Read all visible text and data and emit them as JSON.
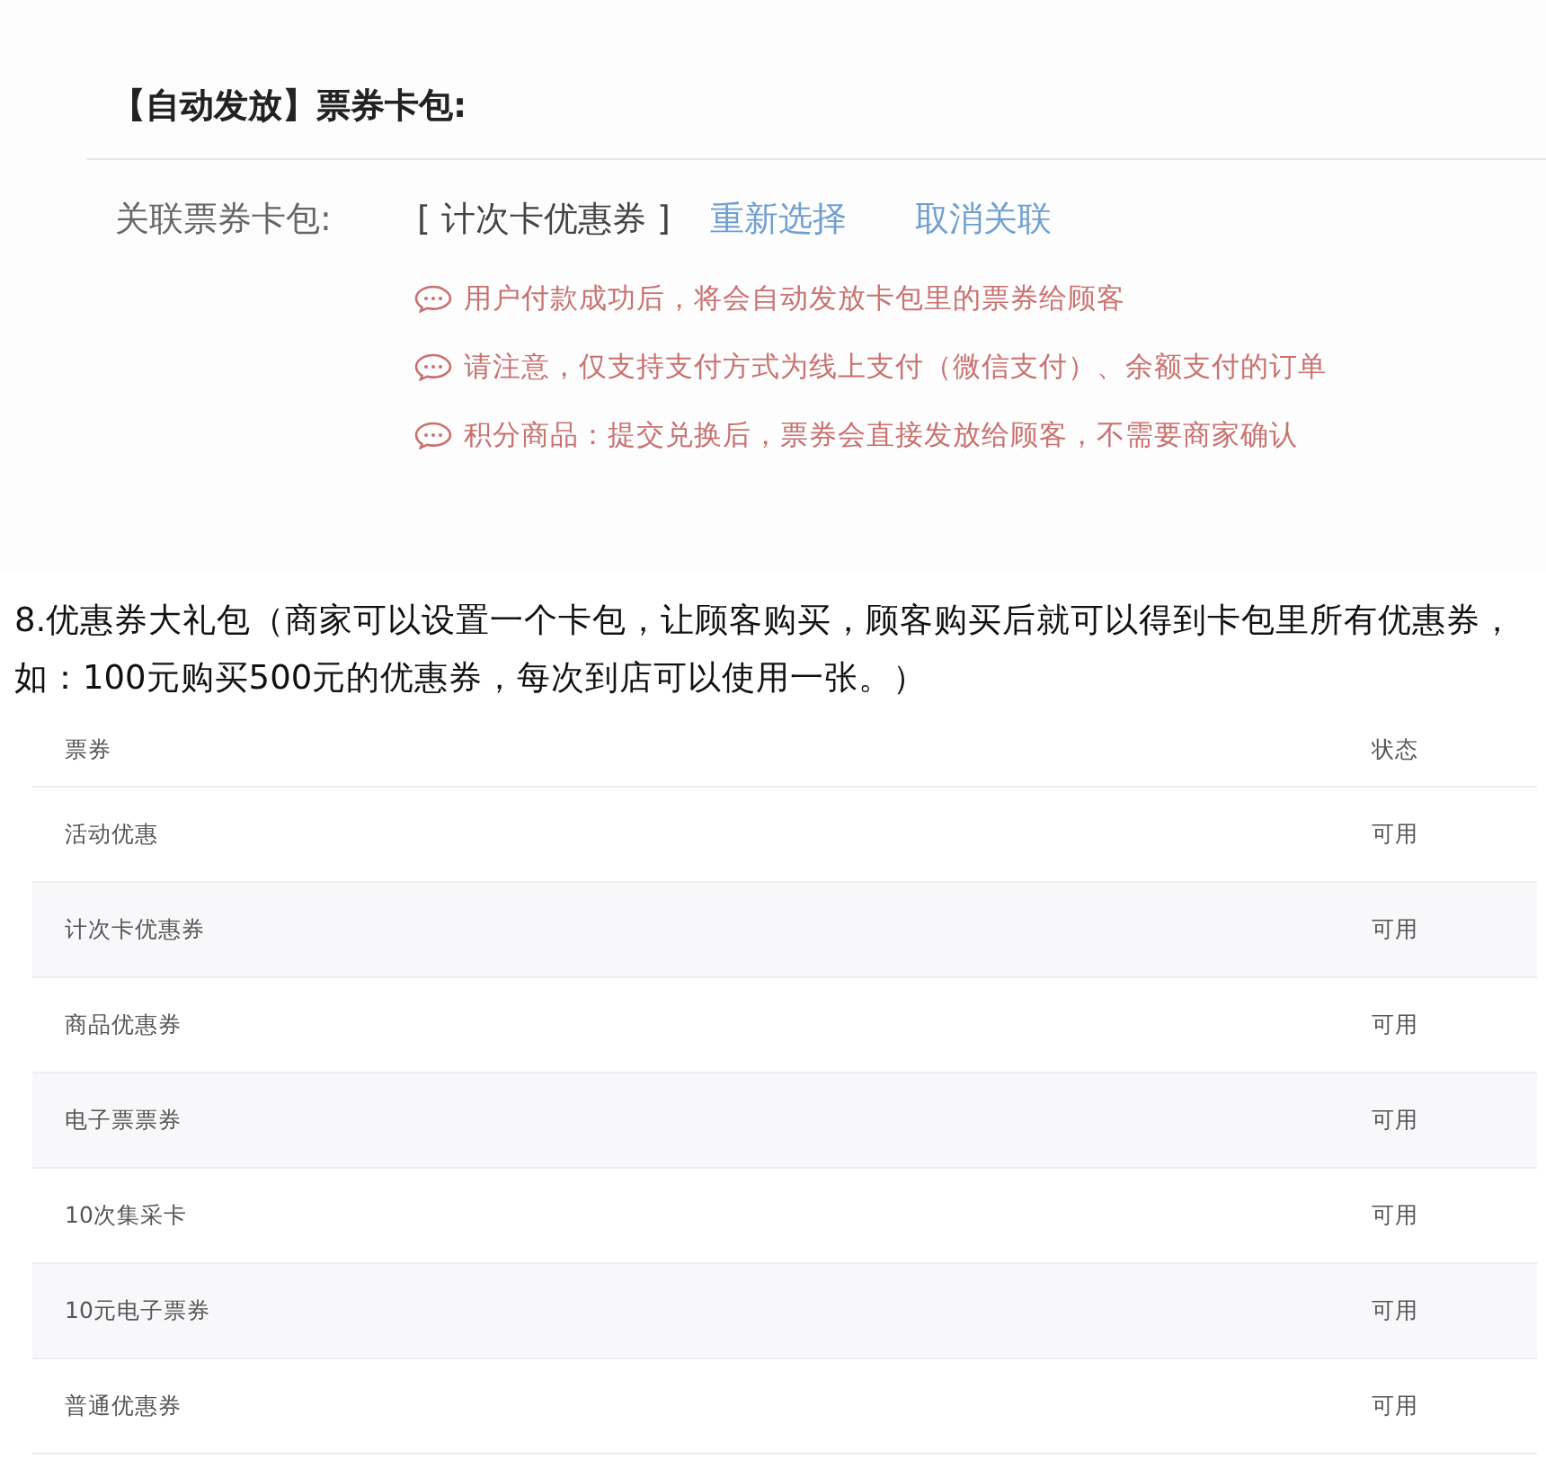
{
  "panel": {
    "title": "【自动发放】票券卡包:",
    "field_label": "关联票券卡包:",
    "field_value": "[ 计次卡优惠券 ]",
    "links": [
      "重新选择",
      "取消关联"
    ],
    "notes": [
      "用户付款成功后，将会自动发放卡包里的票券给顾客",
      "请注意，仅支持支付方式为线上支付（微信支付）、余额支付的订单",
      "积分商品：提交兑换后，票券会直接发放给顾客，不需要商家确认"
    ]
  },
  "paragraph": "8.优惠券大礼包（商家可以设置一个卡包，让顾客购买，顾客购买后就可以得到卡包里所有优惠券，如：100元购买500元的优惠券，每次到店可以使用一张。）",
  "table": {
    "columns": [
      "票券",
      "状态"
    ],
    "rows": [
      [
        "活动优惠",
        "可用"
      ],
      [
        "计次卡优惠券",
        "可用"
      ],
      [
        "商品优惠券",
        "可用"
      ],
      [
        "电子票票券",
        "可用"
      ],
      [
        "10次集采卡",
        "可用"
      ],
      [
        "10元电子票券",
        "可用"
      ],
      [
        "普通优惠券",
        "可用"
      ]
    ]
  }
}
